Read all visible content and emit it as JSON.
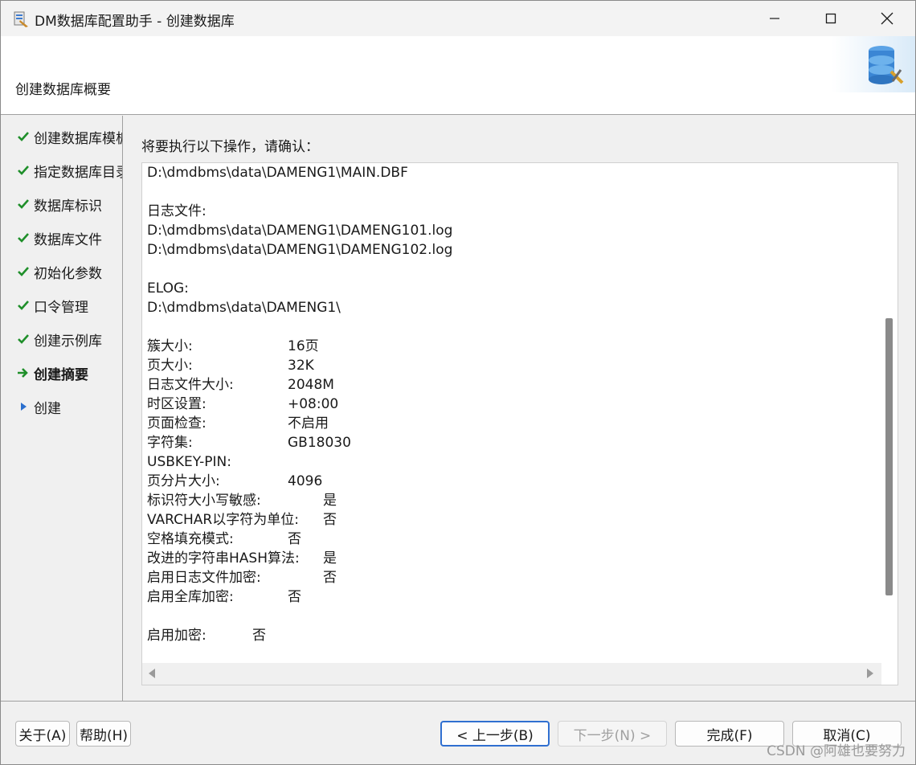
{
  "window": {
    "title": "DM数据库配置助手 - 创建数据库",
    "icons": [
      "app-icon",
      "minimize-icon",
      "maximize-icon",
      "close-icon"
    ]
  },
  "header": {
    "title": "创建数据库概要",
    "logo_icon": "database-config-icon"
  },
  "sidebar": {
    "steps": [
      {
        "label": "创建数据库模板",
        "status": "done",
        "icon": "check-icon"
      },
      {
        "label": "指定数据库目录",
        "status": "done",
        "icon": "check-icon"
      },
      {
        "label": "数据库标识",
        "status": "done",
        "icon": "check-icon"
      },
      {
        "label": "数据库文件",
        "status": "done",
        "icon": "check-icon"
      },
      {
        "label": "初始化参数",
        "status": "done",
        "icon": "check-icon"
      },
      {
        "label": "口令管理",
        "status": "done",
        "icon": "check-icon"
      },
      {
        "label": "创建示例库",
        "status": "done",
        "icon": "check-icon"
      },
      {
        "label": "创建摘要",
        "status": "current",
        "icon": "arrow-right-icon"
      },
      {
        "label": "创建",
        "status": "pending",
        "icon": "triangle-right-icon"
      }
    ]
  },
  "main": {
    "prompt": "将要执行以下操作，请确认：",
    "lines": [
      {
        "text": "D:\\dmdbms\\data\\DAMENG1\\MAIN.DBF"
      },
      {
        "text": ""
      },
      {
        "text": "日志文件:"
      },
      {
        "text": "D:\\dmdbms\\data\\DAMENG1\\DAMENG101.log"
      },
      {
        "text": "D:\\dmdbms\\data\\DAMENG1\\DAMENG102.log"
      },
      {
        "text": ""
      },
      {
        "text": "ELOG:"
      },
      {
        "text": "D:\\dmdbms\\data\\DAMENG1\\"
      },
      {
        "text": ""
      },
      {
        "key": "簇大小:",
        "value": "16页",
        "col": "a"
      },
      {
        "key": "页大小:",
        "value": "32K",
        "col": "a"
      },
      {
        "key": "日志文件大小:",
        "value": "2048M",
        "col": "a"
      },
      {
        "key": "时区设置:",
        "value": "+08:00",
        "col": "a"
      },
      {
        "key": "页面检查:",
        "value": "不启用",
        "col": "a"
      },
      {
        "key": "字符集:",
        "value": "GB18030",
        "col": "a"
      },
      {
        "key": "USBKEY-PIN:",
        "value": "",
        "col": "a"
      },
      {
        "key": "页分片大小:",
        "value": "4096",
        "col": "a"
      },
      {
        "key": "标识符大小写敏感:",
        "value": "是",
        "col": "b"
      },
      {
        "key": "VARCHAR以字符为单位:",
        "value": "否",
        "col": "b"
      },
      {
        "key": "空格填充模式:",
        "value": "否",
        "col": "a"
      },
      {
        "key": "改进的字符串HASH算法:",
        "value": "是",
        "col": "b"
      },
      {
        "key": "启用日志文件加密:",
        "value": "否",
        "col": "b"
      },
      {
        "key": "启用全库加密:",
        "value": "否",
        "col": "a"
      },
      {
        "text": ""
      },
      {
        "key": "启用加密:",
        "value": "否",
        "col": "c"
      }
    ]
  },
  "footer": {
    "about": "关于(A)",
    "help": "帮助(H)",
    "prev": "< 上一步(B)",
    "next": "下一步(N) >",
    "finish": "完成(F)",
    "cancel": "取消(C)"
  },
  "watermark": "CSDN @阿雄也要努力",
  "colors": {
    "check": "#1f8f2a",
    "pending_arrow": "#2b6fce",
    "default_button_border": "#2f6fd0"
  }
}
